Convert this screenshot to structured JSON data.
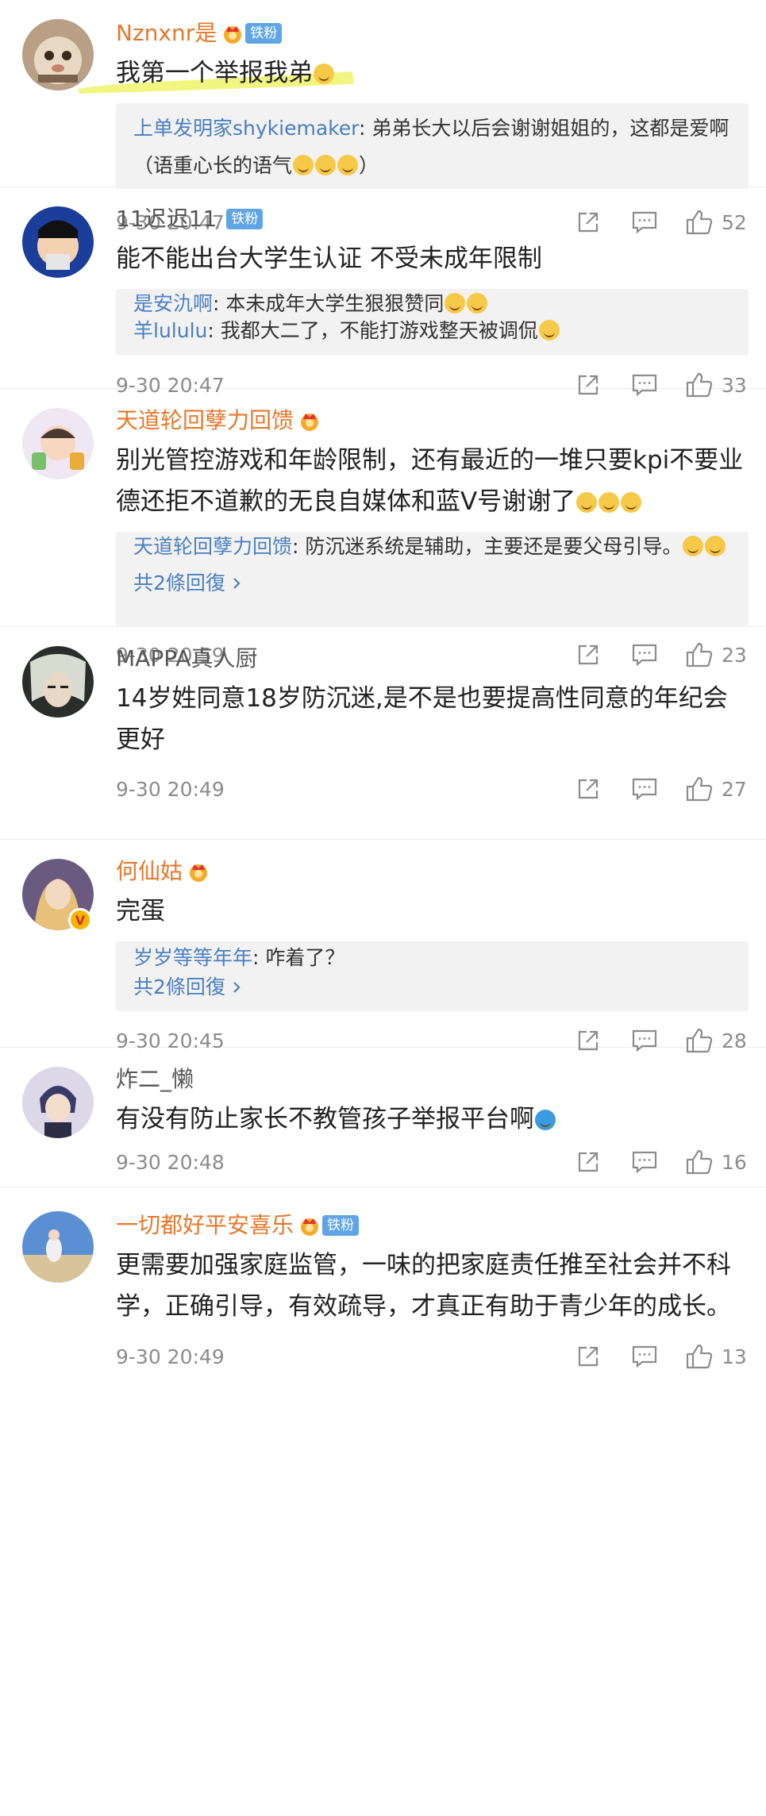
{
  "accent": {
    "orange_name": "#e7772a",
    "reply_blue": "#4a7fc1",
    "fan_badge": "#5fa5e6",
    "highlighter": "#eef56b"
  },
  "icons": {
    "repost": "share-square-icon",
    "reply": "comment-bubble-icon",
    "like": "thumbs-up-icon",
    "crown": "crown-badge-icon",
    "chevron": "chevron-right-icon"
  },
  "comments": [
    {
      "username": "Nznxnr是",
      "fan_badge": "铁粉",
      "text": "我第一个举报我弟",
      "replies": [
        {
          "author": "上单发明家shykiemaker",
          "text": ": 弟弟长大以后会谢谢姐姐的，这都是爱啊（语重心长的语气",
          "suffix": "）"
        }
      ],
      "time": "9-30 20:47",
      "likes": "52"
    },
    {
      "username": "11迟迟11",
      "fan_badge": "铁粉",
      "text": "能不能出台大学生认证 不受未成年限制",
      "replies": [
        {
          "author": "是安氿啊",
          "text": ": 本未成年大学生狠狠赞同"
        },
        {
          "author": "羊lululu",
          "text": ": 我都大二了，不能打游戏整天被调侃"
        }
      ],
      "time": "9-30 20:47",
      "likes": "33"
    },
    {
      "username": "天道轮回孽力回馈",
      "text": "别光管控游戏和年龄限制，还有最近的一堆只要kpi不要业德还拒不道歉的无良自媒体和蓝V号谢谢了",
      "replies": [
        {
          "author": "天道轮回孽力回馈",
          "text": ": 防沉迷系统是辅助，主要还是要父母引导。"
        }
      ],
      "more_replies": "共2條回復",
      "time": "9-30 20:59",
      "likes": "23"
    },
    {
      "username": "MAPPA真人厨",
      "text": "14岁姓同意18岁防沉迷,是不是也要提高性同意的年纪会更好",
      "time": "9-30 20:49",
      "likes": "27"
    },
    {
      "username": "何仙姑",
      "text": "完蛋",
      "replies": [
        {
          "author": "岁岁等等年年",
          "text": ": 咋着了？"
        }
      ],
      "more_replies": "共2條回復",
      "time": "9-30 20:45",
      "likes": "28"
    },
    {
      "username": "炸二_懒",
      "text": "有没有防止家长不教管孩子举报平台啊",
      "time": "9-30 20:48",
      "likes": "16"
    },
    {
      "username": "一切都好平安喜乐",
      "fan_badge": "铁粉",
      "text": "更需要加强家庭监管，一味的把家庭责任推至社会并不科学，正确引导，有效疏导，才真正有助于青少年的成长。",
      "time": "9-30 20:49",
      "likes": "13"
    }
  ]
}
